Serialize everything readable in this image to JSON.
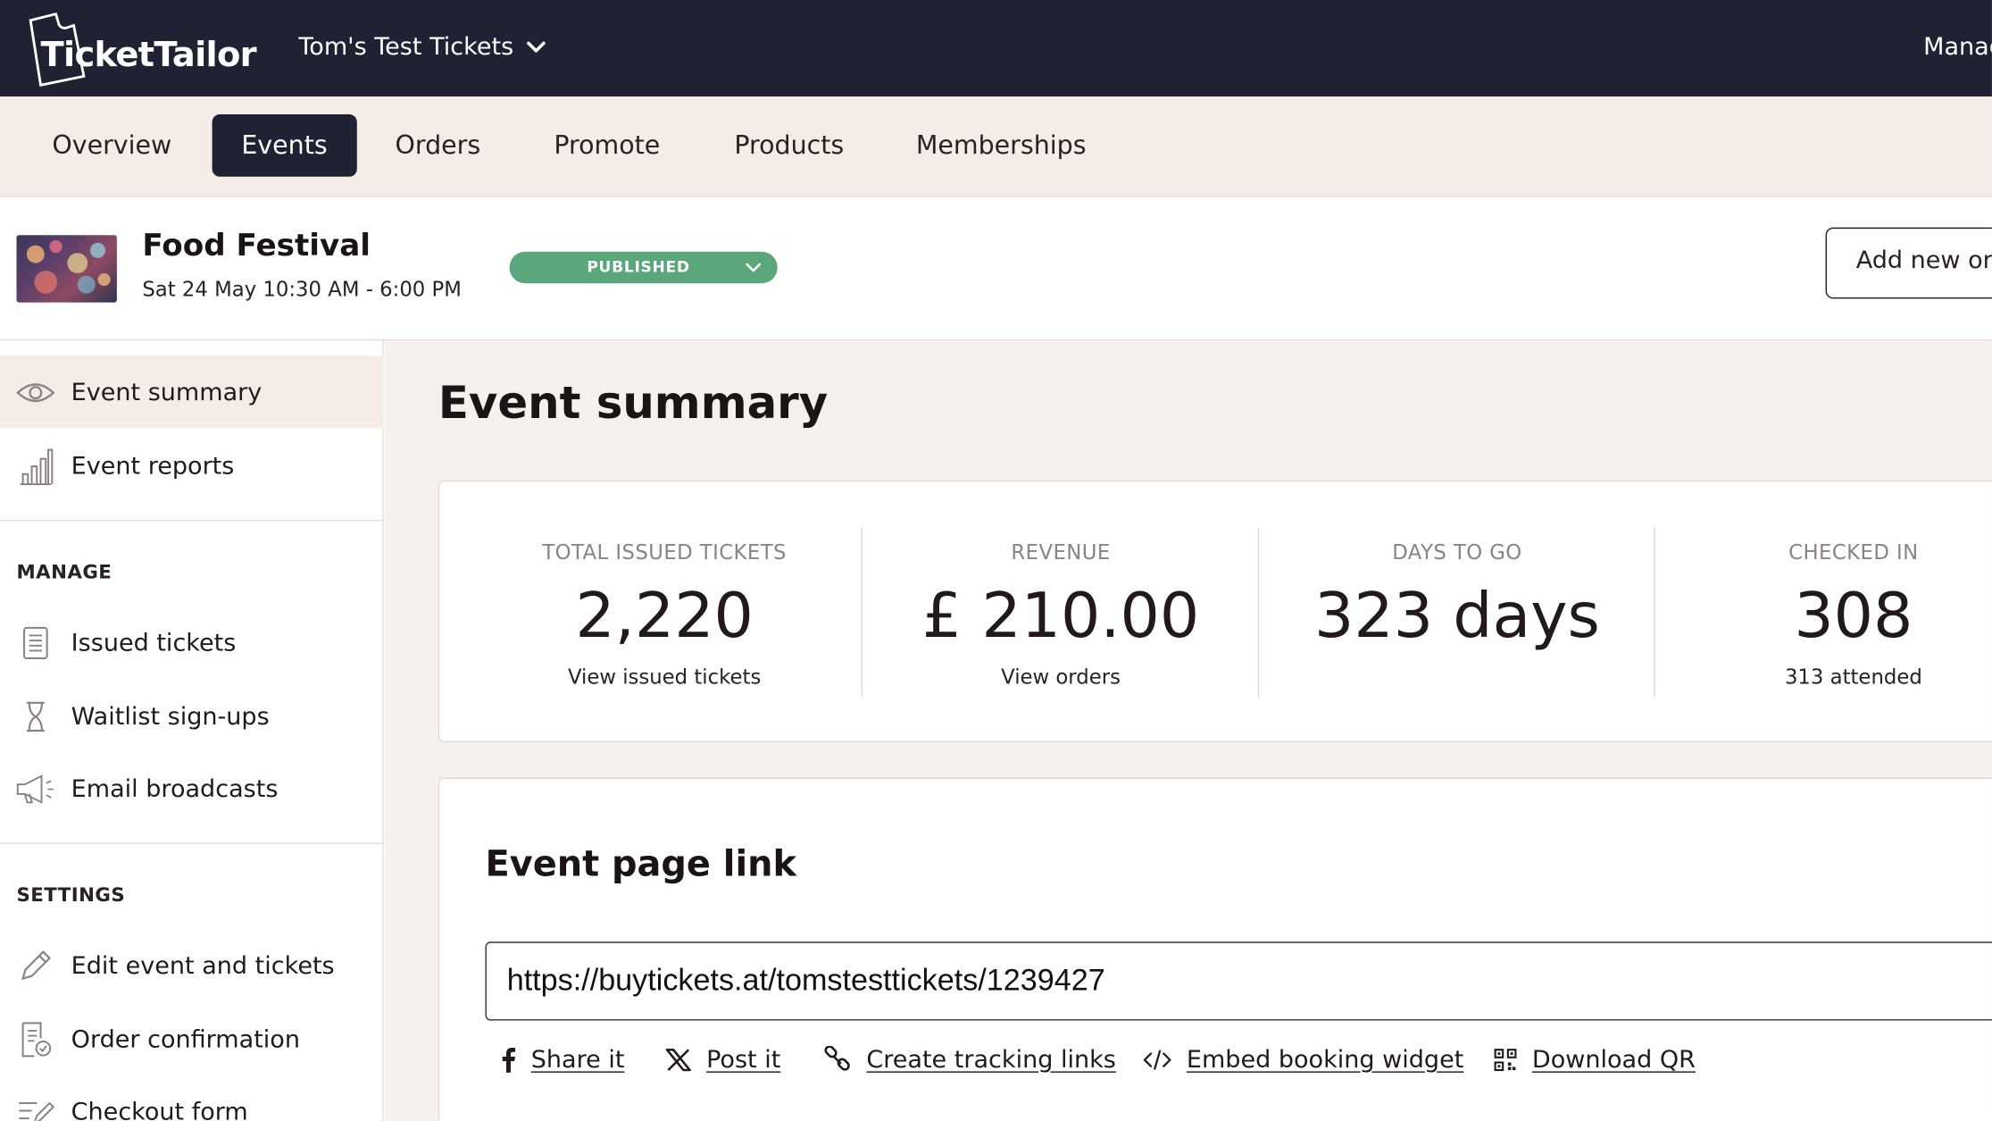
{
  "brand": {
    "logo_text": "TicketTailor",
    "colors": {
      "nav_bg": "#1f2232",
      "tab_bg": "#f5ebe7",
      "published": "#5aa77b",
      "main_bg": "#f7f1ee"
    }
  },
  "header": {
    "account_name": "Tom's Test Tickets",
    "account_icon": "chevron-down-icon",
    "manage_label": "Manag"
  },
  "tabs": [
    {
      "label": "Overview",
      "active": false
    },
    {
      "label": "Events",
      "active": true
    },
    {
      "label": "Orders",
      "active": false
    },
    {
      "label": "Promote",
      "active": false
    },
    {
      "label": "Products",
      "active": false
    },
    {
      "label": "Memberships",
      "active": false
    }
  ],
  "event": {
    "title": "Food Festival",
    "date": "Sat 24 May 10:30 AM - 6:00 PM",
    "status": "PUBLISHED",
    "add_order_label": "Add new or"
  },
  "sidebar": {
    "items": [
      {
        "label": "Event summary",
        "icon": "eye-icon",
        "active": true
      },
      {
        "label": "Event reports",
        "icon": "bar-chart-icon",
        "active": false
      }
    ],
    "manage_heading": "MANAGE",
    "manage_items": [
      {
        "label": "Issued tickets",
        "icon": "ticket-list-icon"
      },
      {
        "label": "Waitlist sign-ups",
        "icon": "hourglass-icon"
      },
      {
        "label": "Email broadcasts",
        "icon": "megaphone-icon"
      }
    ],
    "settings_heading": "SETTINGS",
    "settings_items": [
      {
        "label": "Edit event and tickets",
        "icon": "pencil-icon"
      },
      {
        "label": "Order confirmation",
        "icon": "document-check-icon"
      },
      {
        "label": "Checkout form",
        "icon": "form-edit-icon"
      }
    ]
  },
  "main": {
    "title": "Event summary",
    "stats": [
      {
        "caption": "TOTAL ISSUED TICKETS",
        "value": "2,220",
        "sub": "View issued tickets"
      },
      {
        "caption": "REVENUE",
        "value": "£ 210.00",
        "sub": "View orders"
      },
      {
        "caption": "DAYS TO GO",
        "value": "323 days",
        "sub": ""
      },
      {
        "caption": "CHECKED IN",
        "value": "308",
        "sub": "313 attended"
      }
    ],
    "link_section": {
      "title": "Event page link",
      "url": "https://buytickets.at/tomstesttickets/1239427",
      "actions": [
        {
          "label": "Share it",
          "icon": "facebook-icon"
        },
        {
          "label": "Post it",
          "icon": "x-icon"
        },
        {
          "label": "Create tracking links",
          "icon": "link-icon"
        },
        {
          "label": "Embed booking widget",
          "icon": "code-icon"
        },
        {
          "label": "Download QR",
          "icon": "qr-code-icon"
        }
      ]
    }
  }
}
